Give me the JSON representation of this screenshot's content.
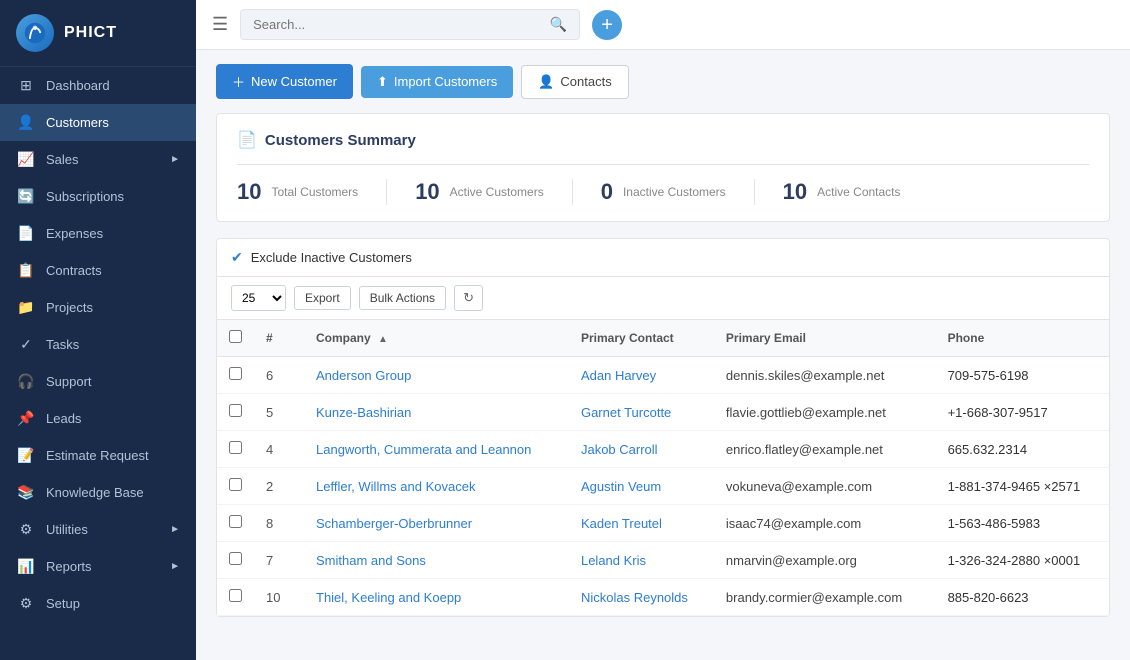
{
  "app": {
    "name": "PHICT",
    "logo_text": "PHICT"
  },
  "topbar": {
    "search_placeholder": "Search...",
    "plus_label": "+"
  },
  "sidebar": {
    "items": [
      {
        "id": "dashboard",
        "label": "Dashboard",
        "icon": "⊞",
        "active": false
      },
      {
        "id": "customers",
        "label": "Customers",
        "icon": "👤",
        "active": true
      },
      {
        "id": "sales",
        "label": "Sales",
        "icon": "📈",
        "active": false,
        "has_chevron": true
      },
      {
        "id": "subscriptions",
        "label": "Subscriptions",
        "icon": "🔄",
        "active": false
      },
      {
        "id": "expenses",
        "label": "Expenses",
        "icon": "📄",
        "active": false
      },
      {
        "id": "contracts",
        "label": "Contracts",
        "icon": "📋",
        "active": false
      },
      {
        "id": "projects",
        "label": "Projects",
        "icon": "📁",
        "active": false
      },
      {
        "id": "tasks",
        "label": "Tasks",
        "icon": "✓",
        "active": false
      },
      {
        "id": "support",
        "label": "Support",
        "icon": "🎧",
        "active": false
      },
      {
        "id": "leads",
        "label": "Leads",
        "icon": "📌",
        "active": false
      },
      {
        "id": "estimate-request",
        "label": "Estimate Request",
        "icon": "📝",
        "active": false
      },
      {
        "id": "knowledge-base",
        "label": "Knowledge Base",
        "icon": "📚",
        "active": false
      },
      {
        "id": "utilities",
        "label": "Utilities",
        "icon": "⚙",
        "active": false,
        "has_chevron": true
      },
      {
        "id": "reports",
        "label": "Reports",
        "icon": "📊",
        "active": false,
        "has_chevron": true
      },
      {
        "id": "setup",
        "label": "Setup",
        "icon": "⚙",
        "active": false
      }
    ]
  },
  "action_bar": {
    "new_customer_label": "New Customer",
    "import_customers_label": "Import Customers",
    "contacts_label": "Contacts"
  },
  "summary": {
    "title": "Customers Summary",
    "stats": [
      {
        "number": "10",
        "label": "Total Customers"
      },
      {
        "number": "10",
        "label": "Active Customers"
      },
      {
        "number": "0",
        "label": "Inactive Customers"
      },
      {
        "number": "10",
        "label": "Active Contacts"
      }
    ]
  },
  "table_controls": {
    "exclude_label": "Exclude Inactive Customers",
    "per_page_value": "25",
    "export_label": "Export",
    "bulk_actions_label": "Bulk Actions",
    "refresh_icon": "↻"
  },
  "table": {
    "columns": [
      {
        "id": "num",
        "label": "#"
      },
      {
        "id": "company",
        "label": "Company",
        "sortable": true
      },
      {
        "id": "primary_contact",
        "label": "Primary Contact"
      },
      {
        "id": "primary_email",
        "label": "Primary Email"
      },
      {
        "id": "phone",
        "label": "Phone"
      }
    ],
    "rows": [
      {
        "id": 1,
        "num": "6",
        "company": "Anderson Group",
        "contact": "Adan Harvey",
        "email": "dennis.skiles@example.net",
        "phone": "709-575-6198"
      },
      {
        "id": 2,
        "num": "5",
        "company": "Kunze-Bashirian",
        "contact": "Garnet Turcotte",
        "email": "flavie.gottlieb@example.net",
        "phone": "+1-668-307-9517"
      },
      {
        "id": 3,
        "num": "4",
        "company": "Langworth, Cummerata and Leannon",
        "contact": "Jakob Carroll",
        "email": "enrico.flatley@example.net",
        "phone": "665.632.2314"
      },
      {
        "id": 4,
        "num": "2",
        "company": "Leffler, Willms and Kovacek",
        "contact": "Agustin Veum",
        "email": "vokuneva@example.com",
        "phone": "1-881-374-9465 ×2571"
      },
      {
        "id": 5,
        "num": "8",
        "company": "Schamberger-Oberbrunner",
        "contact": "Kaden Treutel",
        "email": "isaac74@example.com",
        "phone": "1-563-486-5983"
      },
      {
        "id": 6,
        "num": "7",
        "company": "Smitham and Sons",
        "contact": "Leland Kris",
        "email": "nmarvin@example.org",
        "phone": "1-326-324-2880 ×0001"
      },
      {
        "id": 7,
        "num": "10",
        "company": "Thiel, Keeling and Koepp",
        "contact": "Nickolas Reynolds",
        "email": "brandy.cormier@example.com",
        "phone": "885-820-6623"
      }
    ]
  }
}
